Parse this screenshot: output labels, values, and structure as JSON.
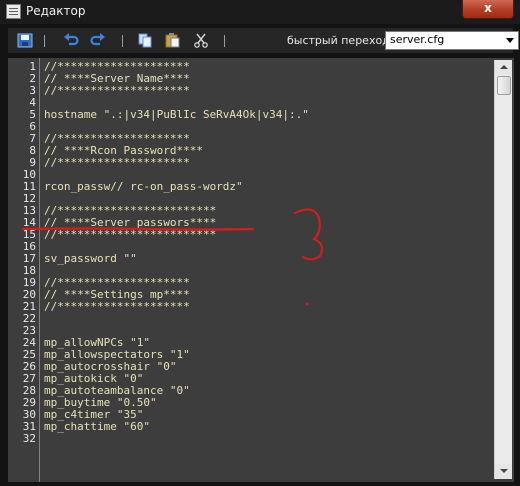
{
  "window": {
    "title": "Редактор",
    "close_label": "x"
  },
  "toolbar": {
    "icons": [
      "save-icon",
      "undo-icon",
      "redo-icon",
      "copy-icon",
      "paste-icon",
      "cut-icon"
    ],
    "goto_label": "быстрый переход:",
    "goto_value": "server.cfg"
  },
  "editor": {
    "line_numbers": [
      "1",
      "2",
      "3",
      "4",
      "5",
      "6",
      "7",
      "8",
      "9",
      "10",
      "11",
      "12",
      "13",
      "14",
      "15",
      "16",
      "17",
      "18",
      "19",
      "20",
      "21",
      "22",
      "23",
      "24",
      "25",
      "26",
      "27",
      "28",
      "29",
      "30",
      "31",
      "32"
    ],
    "lines": [
      "//********************",
      "// ****Server Name****",
      "//********************",
      "",
      "hostname \".:|v34|PuBlIc SeRvA4Ok|v34|:.\"",
      "",
      "//********************",
      "// ****Rcon Password****",
      "//********************",
      "",
      "rcon_passw// rc-on_pass-wordz\"",
      "",
      "//************************",
      "// ****Server passwors****",
      "//************************",
      "",
      "sv_password \"\"",
      "",
      "//********************",
      "// ****Settings mp****",
      "//********************",
      "",
      "",
      "mp_allowNPCs \"1\"",
      "mp_allowspectators \"1\"",
      "mp_autocrosshair \"0\"",
      "mp_autokick \"0\"",
      "mp_autoteambalance \"0\"",
      "mp_buytime \"0.50\"",
      "mp_c4timer \"35\"",
      "mp_chattime \"60\"",
      ""
    ]
  },
  "colors": {
    "text": "#e6e2b6",
    "editor_bg": "#3d3d3d",
    "annotation": "#e0191c"
  }
}
